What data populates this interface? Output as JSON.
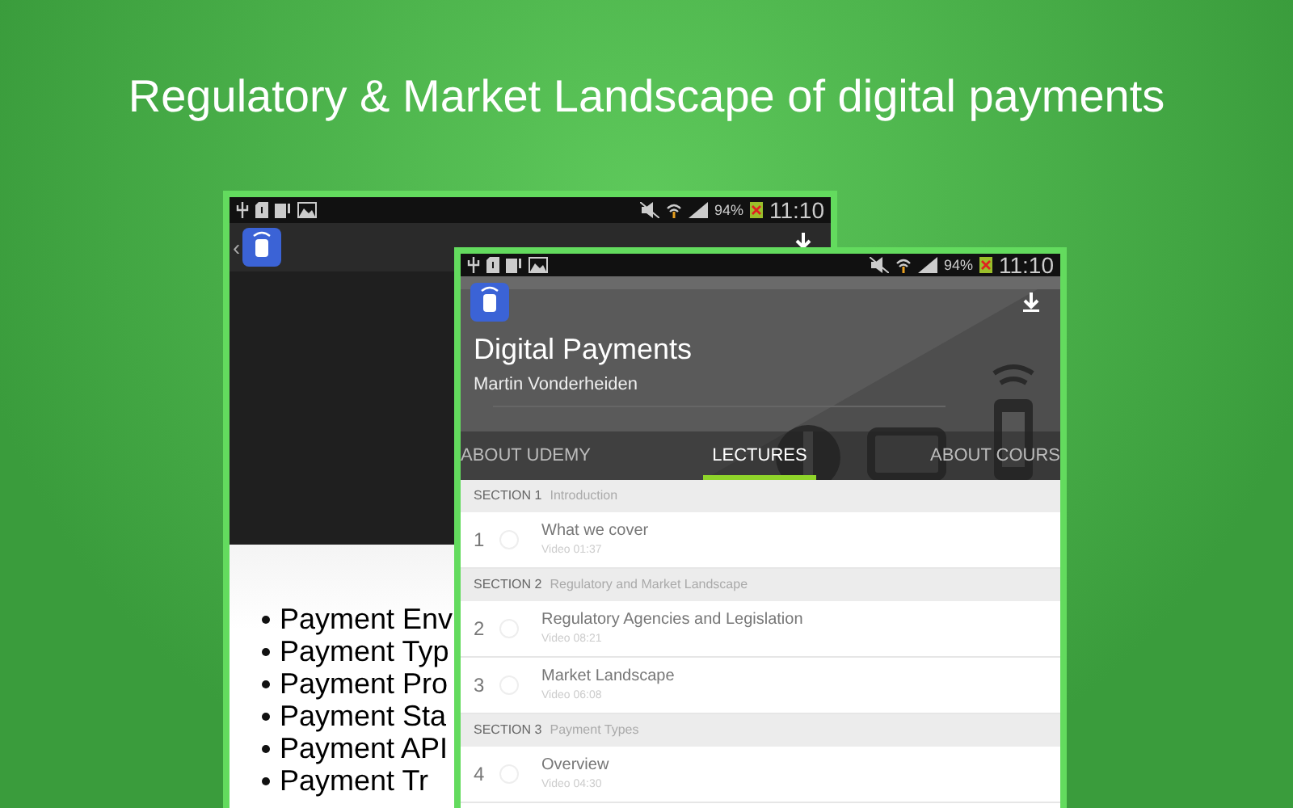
{
  "headline": "Regulatory & Market Landscape of digital payments",
  "back_phone": {
    "status_bar": {
      "battery": "94%",
      "time": "11:10"
    },
    "back_mark": "‹",
    "slide_bullets": [
      "Payment Env",
      "Payment Typ",
      "Payment Pro",
      "Payment Sta",
      "Payment API",
      "Payment Tr"
    ]
  },
  "front_phone": {
    "status_bar": {
      "battery": "94%",
      "time": "11:10"
    },
    "course": {
      "title": "Digital Payments",
      "author": "Martin Vonderheiden"
    },
    "tabs": [
      {
        "label": "ABOUT UDEMY",
        "selected": false
      },
      {
        "label": "LECTURES",
        "selected": true
      },
      {
        "label": "ABOUT COURS",
        "selected": false
      }
    ],
    "sections": [
      {
        "label": "SECTION 1",
        "title": "Introduction",
        "lectures": [
          {
            "number": "1",
            "title": "What we cover",
            "meta": "Video 01:37"
          }
        ]
      },
      {
        "label": "SECTION 2",
        "title": "Regulatory and Market Landscape",
        "lectures": [
          {
            "number": "2",
            "title": "Regulatory Agencies and Legislation",
            "meta": "Video 08:21"
          },
          {
            "number": "3",
            "title": "Market Landscape",
            "meta": "Video 06:08"
          }
        ]
      },
      {
        "label": "SECTION 3",
        "title": "Payment Types",
        "lectures": [
          {
            "number": "4",
            "title": "Overview",
            "meta": "Video 04:30"
          }
        ]
      }
    ]
  }
}
